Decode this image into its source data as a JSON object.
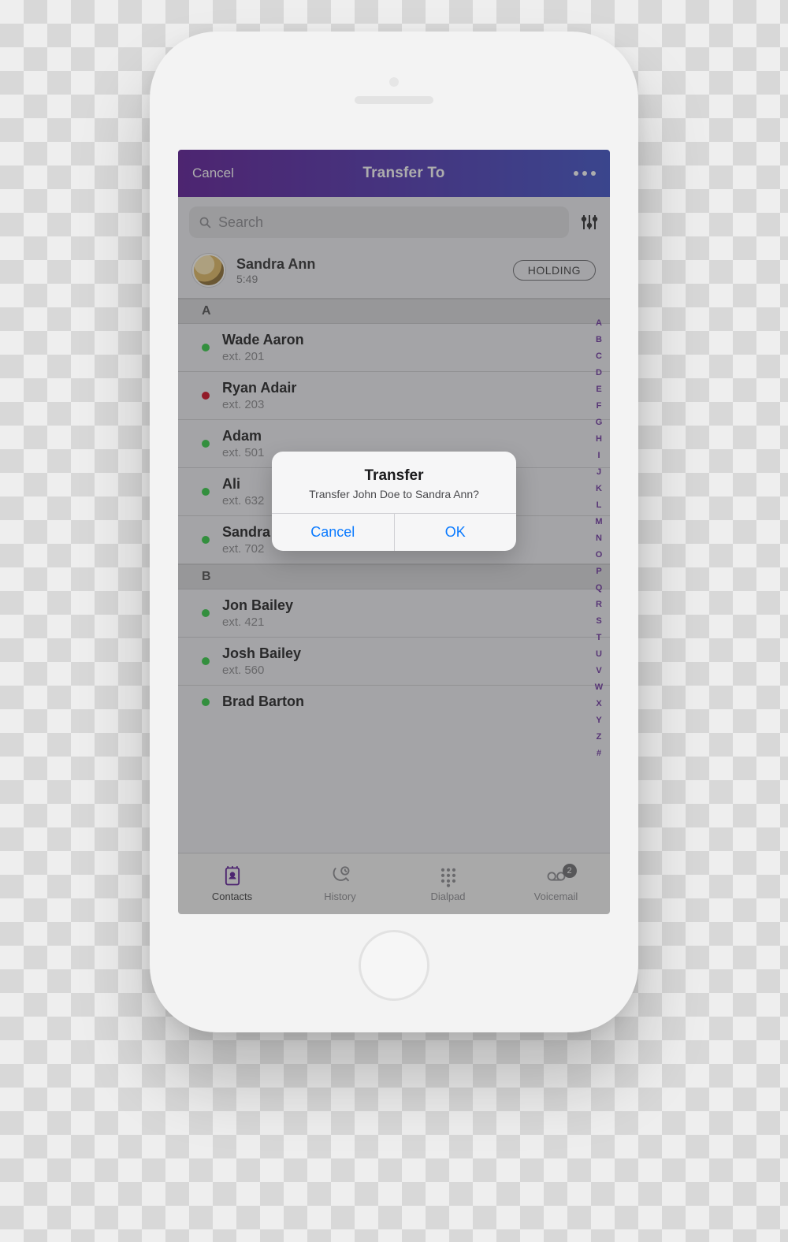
{
  "header": {
    "cancel_label": "Cancel",
    "title": "Transfer To"
  },
  "search": {
    "placeholder": "Search"
  },
  "caller": {
    "name": "Sandra Ann",
    "time": "5:49",
    "status": "HOLDING"
  },
  "sections": [
    {
      "letter": "A",
      "contacts": [
        {
          "name": "Wade Aaron",
          "ext": "ext. 201",
          "status_color": "#2ecc40"
        },
        {
          "name": "Ryan Adair",
          "ext": "ext. 203",
          "status_color": "#d0021b"
        },
        {
          "name": "Adam",
          "ext": "ext. 501",
          "status_color": "#2ecc40"
        },
        {
          "name": "Ali",
          "ext": "ext. 632",
          "status_color": "#2ecc40"
        },
        {
          "name": "Sandra Ann",
          "ext": "ext. 702",
          "status_color": "#2ecc40"
        }
      ]
    },
    {
      "letter": "B",
      "contacts": [
        {
          "name": "Jon Bailey",
          "ext": "ext. 421",
          "status_color": "#2ecc40"
        },
        {
          "name": "Josh Bailey",
          "ext": "ext. 560",
          "status_color": "#2ecc40"
        },
        {
          "name": "Brad Barton",
          "ext": "",
          "status_color": "#2ecc40"
        }
      ]
    }
  ],
  "az_index": [
    "A",
    "B",
    "C",
    "D",
    "E",
    "F",
    "G",
    "H",
    "I",
    "J",
    "K",
    "L",
    "M",
    "N",
    "O",
    "P",
    "Q",
    "R",
    "S",
    "T",
    "U",
    "V",
    "W",
    "X",
    "Y",
    "Z",
    "#"
  ],
  "tabs": {
    "contacts": "Contacts",
    "history": "History",
    "dialpad": "Dialpad",
    "voicemail": "Voicemail",
    "voicemail_badge": "2"
  },
  "dialog": {
    "title": "Transfer",
    "message": "Transfer John Doe to Sandra Ann?",
    "cancel": "Cancel",
    "ok": "OK"
  }
}
